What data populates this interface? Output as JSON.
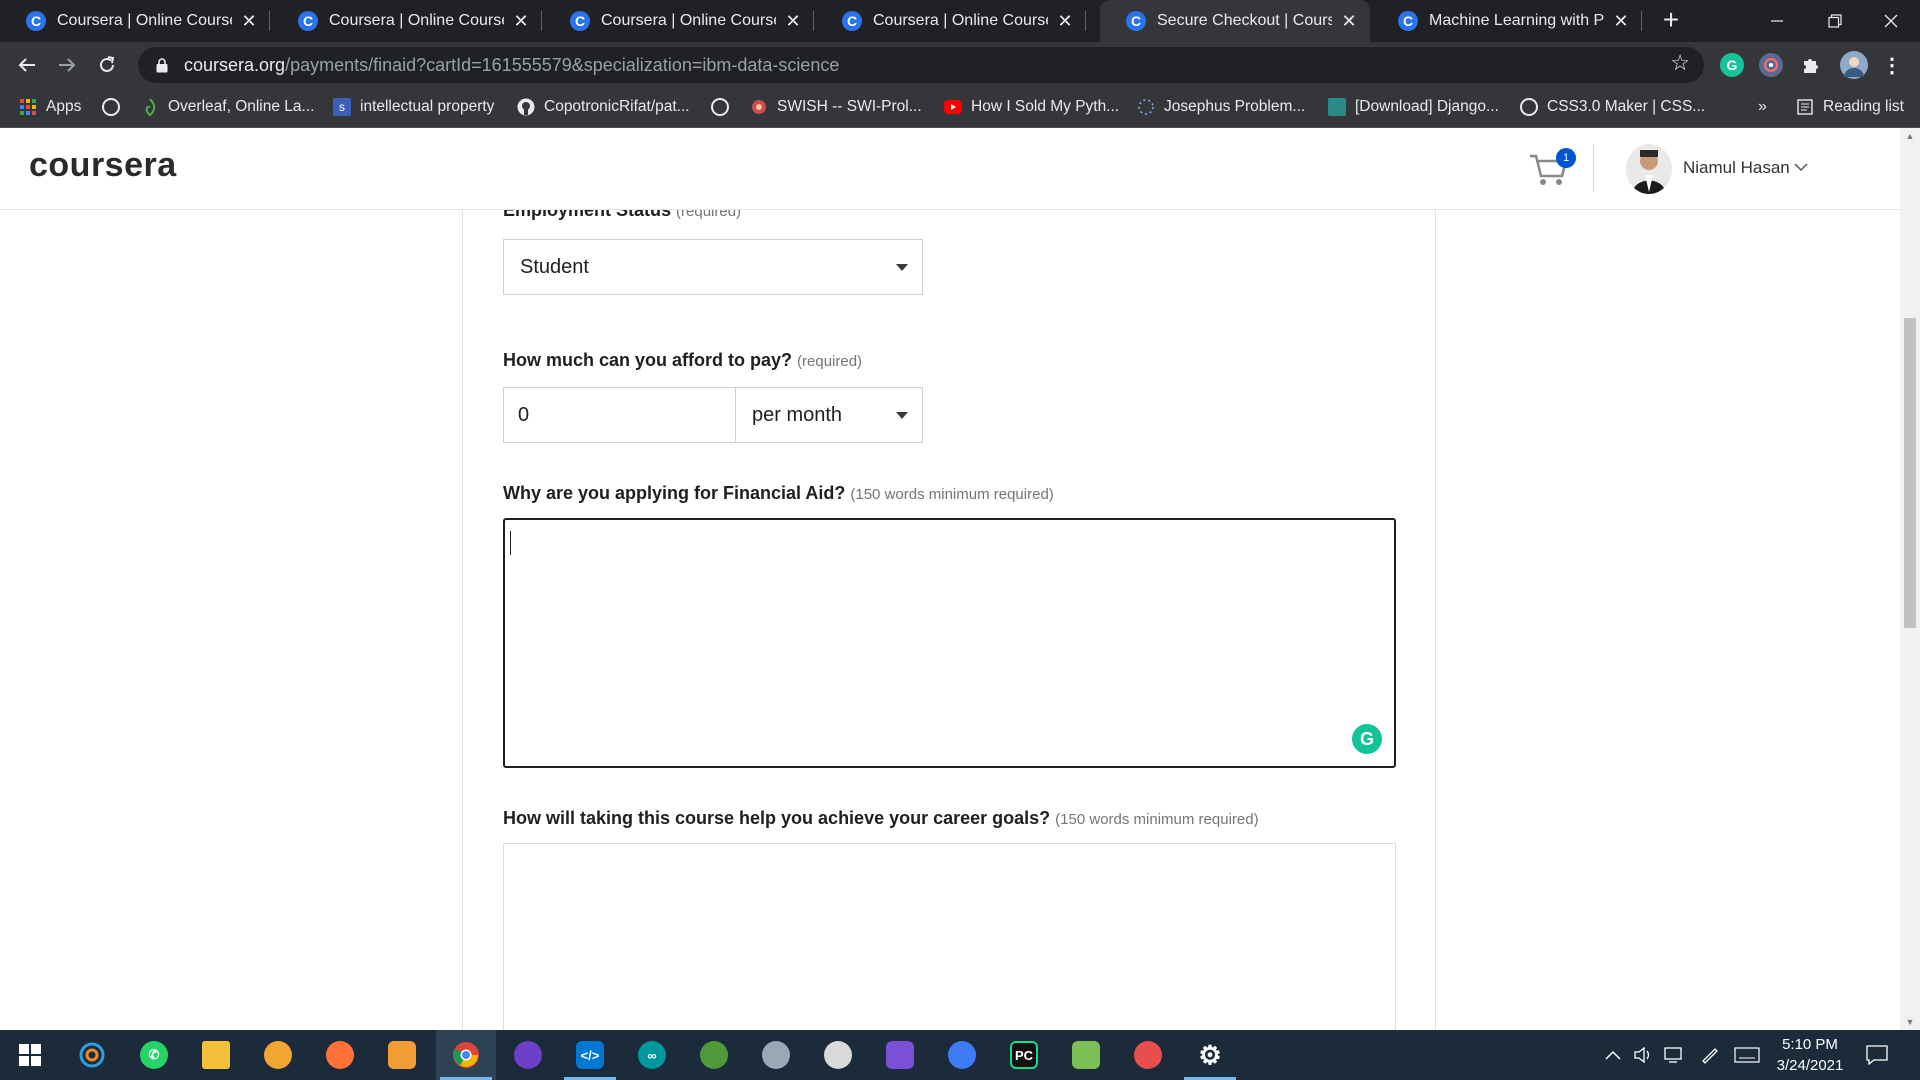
{
  "browser": {
    "tabs": [
      {
        "title": "Coursera | Online Courses &",
        "favicon": "C",
        "active": false
      },
      {
        "title": "Coursera | Online Courses &",
        "favicon": "C",
        "active": false
      },
      {
        "title": "Coursera | Online Courses &",
        "favicon": "C",
        "active": false
      },
      {
        "title": "Coursera | Online Courses &",
        "favicon": "C",
        "active": false
      },
      {
        "title": "Secure Checkout | Coursera",
        "favicon": "C",
        "active": true
      },
      {
        "title": "Machine Learning with Pytho",
        "favicon": "C",
        "active": false
      }
    ],
    "close_glyph": "✕",
    "new_tab_glyph": "+",
    "url_host": "coursera.org",
    "url_rest": "/payments/finaid?cartId=161555579&specialization=ibm-data-science",
    "grammarly_ext": "G",
    "bookmarks": [
      {
        "label": "Apps",
        "icon": "apps-grid-icon"
      },
      {
        "label": "",
        "icon": "globe-icon"
      },
      {
        "label": "Overleaf, Online La...",
        "icon": "overleaf-icon"
      },
      {
        "label": "intellectual property",
        "icon": "s-bookmark-icon",
        "icon_text": "s"
      },
      {
        "label": "CopotronicRifat/pat...",
        "icon": "github-icon"
      },
      {
        "label": "",
        "icon": "globe-icon"
      },
      {
        "label": "SWISH -- SWI-Prol...",
        "icon": "swish-icon"
      },
      {
        "label": "How I Sold My Pyth...",
        "icon": "youtube-icon"
      },
      {
        "label": "Josephus Problem...",
        "icon": "loading-icon"
      },
      {
        "label": "[Download] Django...",
        "icon": "django-icon"
      },
      {
        "label": "CSS3.0 Maker | CSS...",
        "icon": "globe-icon"
      }
    ],
    "bookmarks_overflow": "»",
    "reading_list": "Reading list"
  },
  "header": {
    "logo": "coursera",
    "cart_count": "1",
    "user_name": "Niamul Hasan"
  },
  "form": {
    "employment": {
      "label": "Employment Status",
      "hint": "(required)",
      "value": "Student"
    },
    "afford": {
      "label": "How much can you afford to pay?",
      "hint": "(required)",
      "amount": "0",
      "period": "per month"
    },
    "why_aid": {
      "label": "Why are you applying for Financial Aid?",
      "hint": "(150 words minimum required)",
      "value": ""
    },
    "career": {
      "label": "How will taking this course help you achieve your career goals?",
      "hint": "(150 words minimum required)",
      "value": ""
    }
  },
  "taskbar": {
    "apps": [
      "start-icon",
      "cortana-icon",
      "whatsapp-icon",
      "file-explorer-icon",
      "brave-icon",
      "firefox-icon",
      "picture-viewer-icon",
      "chrome-icon",
      "github-desktop-icon",
      "vscode-icon",
      "arduino-icon",
      "geogebra-icon",
      "app-icon",
      "app-icon",
      "visual-studio-icon",
      "messenger-icon",
      "pycharm-icon",
      "notepad-icon",
      "app-icon",
      "settings-icon"
    ],
    "time": "5:10 PM",
    "date": "3/24/2021"
  },
  "colors": {
    "chrome_dark": "#202124",
    "chrome_toolbar": "#35363a",
    "coursera_blue": "#0056d2",
    "grammarly_green": "#15c39a",
    "taskbar": "#1c2b3a"
  }
}
